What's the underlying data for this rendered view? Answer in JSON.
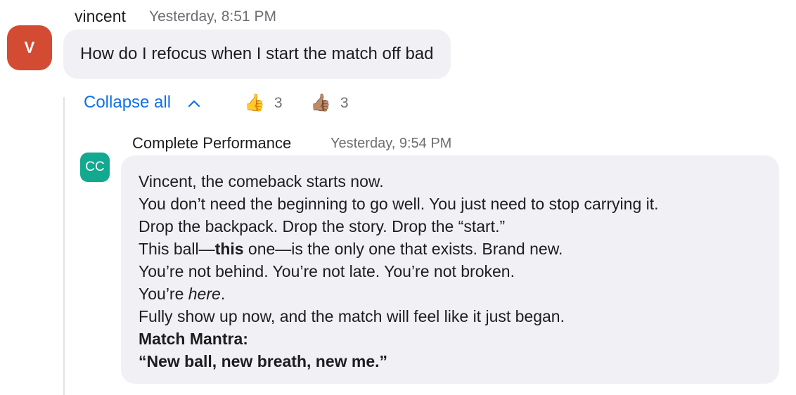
{
  "message": {
    "avatar_initial": "V",
    "author": "vincent",
    "timestamp": "Yesterday, 8:51 PM",
    "text": "How do I refocus when I start the match off bad",
    "avatar_color": "#d24b32"
  },
  "thread": {
    "collapse_label": "Collapse all",
    "collapse_icon": "chevron-up-icon",
    "reactions": [
      {
        "emoji": "👍",
        "icon": "thumbs-up-icon",
        "count": "3"
      },
      {
        "emoji": "👍🏽",
        "icon": "thumbs-up-medium-skin-icon",
        "count": "3"
      }
    ]
  },
  "reply": {
    "avatar_initials": "CC",
    "author": "Complete Performance",
    "timestamp": "Yesterday, 9:54 PM",
    "avatar_color": "#12a990",
    "lines": {
      "l1": "Vincent, the comeback starts now.",
      "l2": "You don’t need the beginning to go well. You just need to stop carrying it.",
      "l3": "Drop the backpack. Drop the story. Drop the “start.”",
      "l4a": "This ball—",
      "l4b": "this",
      "l4c": " one—is the only one that exists. Brand new.",
      "l5": "You’re not behind. You’re not late. You’re not broken.",
      "l6a": "You’re ",
      "l6b": "here",
      "l6c": ".",
      "l7": "Fully show up now, and the match will feel like it just began.",
      "l8": "Match Mantra:",
      "l9": "“New ball, new breath, new me.”"
    }
  }
}
